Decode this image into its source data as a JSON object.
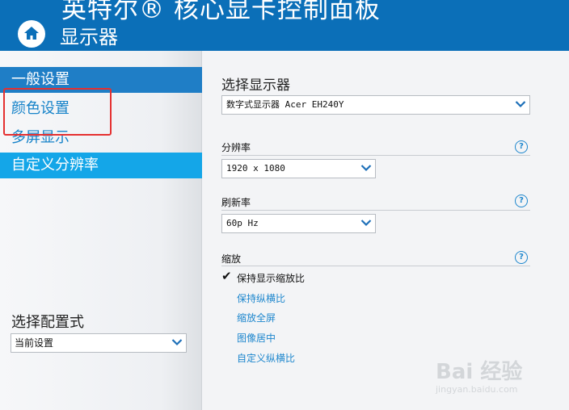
{
  "header": {
    "app_title": "英特尔® 核心显卡控制面板",
    "page_title": "显示器"
  },
  "sidebar": {
    "items": [
      {
        "label": "一般设置"
      },
      {
        "label": "颜色设置"
      },
      {
        "label": "多屏显示"
      },
      {
        "label": "自定义分辨率"
      }
    ],
    "preset_label": "选择配置式",
    "preset_value": "当前设置"
  },
  "main": {
    "select_display_label": "选择显示器",
    "display_value": "数字式显示器 Acer EH240Y",
    "resolution_label": "分辨率",
    "resolution_value": "1920 x 1080",
    "refresh_label": "刷新率",
    "refresh_value": "60p Hz",
    "scaling_label": "缩放",
    "scaling_options": [
      {
        "label": "保持显示缩放比",
        "checked": true
      },
      {
        "label": "保持纵横比"
      },
      {
        "label": "缩放全屏"
      },
      {
        "label": "图像居中"
      },
      {
        "label": "自定义纵横比"
      }
    ],
    "help_glyph": "?"
  },
  "watermark": {
    "text": "Bai 经验",
    "url": "jingyan.baidu.com"
  },
  "colors": {
    "header_bg": "#0b6fb8",
    "nav_selected_bg": "#1f7ec6",
    "nav_active_bg": "#14a6e8",
    "link": "#1d86cd",
    "highlight_box": "#e53030"
  },
  "icons": {
    "home": "home-icon",
    "dropdown": "chevron-down-icon",
    "help": "help-icon",
    "checkmark": "checkmark-icon"
  }
}
